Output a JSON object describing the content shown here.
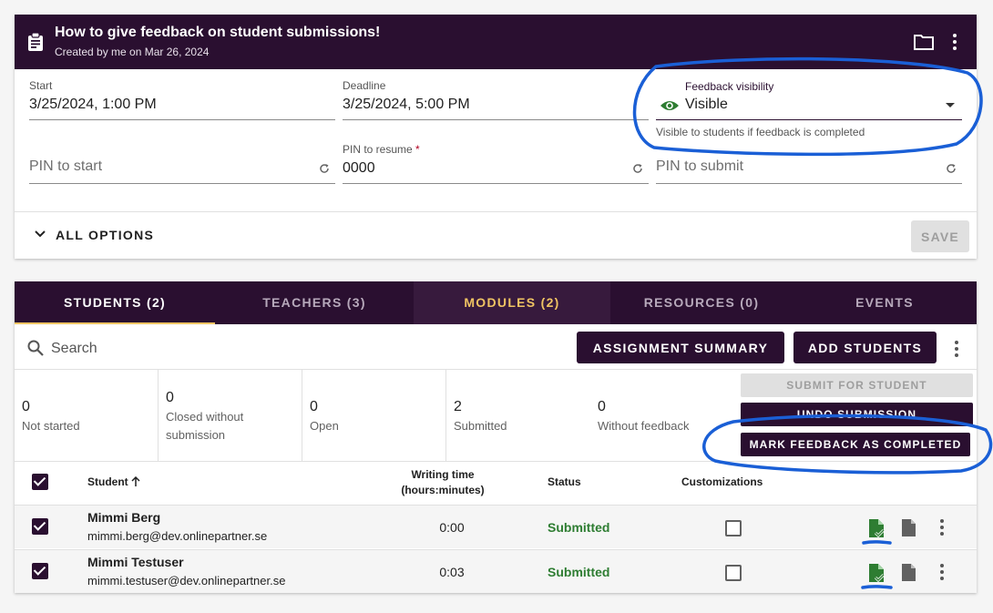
{
  "assignment": {
    "title": "How to give feedback on student submissions!",
    "subtitle": "Created by me on Mar 26, 2024",
    "header_icons": [
      "clipboard-icon",
      "folder-icon",
      "more-vert-icon"
    ]
  },
  "fields": {
    "start": {
      "label": "Start",
      "value": "3/25/2024, 1:00 PM"
    },
    "deadline": {
      "label": "Deadline",
      "value": "3/25/2024, 5:00 PM"
    },
    "feedback_visibility": {
      "label": "Feedback visibility",
      "value": "Visible",
      "hint": "Visible to students if feedback is completed",
      "icon": "eye-icon"
    },
    "pin_start": {
      "placeholder": "PIN to start"
    },
    "pin_resume": {
      "label": "PIN to resume",
      "required_mark": "*",
      "value": "0000"
    },
    "pin_submit": {
      "placeholder": "PIN to submit"
    }
  },
  "options": {
    "all_options_label": "ALL OPTIONS",
    "save_label": "SAVE"
  },
  "tabs": [
    {
      "label": "STUDENTS (2)",
      "active": true
    },
    {
      "label": "TEACHERS (3)"
    },
    {
      "label": "MODULES (2)",
      "highlight": true
    },
    {
      "label": "RESOURCES (0)"
    },
    {
      "label": "EVENTS"
    }
  ],
  "toolbar": {
    "search_placeholder": "Search",
    "assignment_summary_label": "ASSIGNMENT SUMMARY",
    "add_students_label": "ADD STUDENTS"
  },
  "stats": [
    {
      "value": "0",
      "label": "Not started"
    },
    {
      "value": "0",
      "label": "Closed without submission"
    },
    {
      "value": "0",
      "label": "Open"
    },
    {
      "value": "2",
      "label": "Submitted"
    },
    {
      "value": "0",
      "label": "Without feedback"
    }
  ],
  "actions": {
    "submit_for_student": "SUBMIT FOR STUDENT",
    "undo_submission": "UNDO SUBMISSION",
    "mark_feedback_completed": "MARK FEEDBACK AS COMPLETED"
  },
  "table": {
    "headers": {
      "student": "Student",
      "writing_time_line1": "Writing time",
      "writing_time_line2": "(hours:minutes)",
      "status": "Status",
      "customizations": "Customizations"
    },
    "rows": [
      {
        "name": "Mimmi Berg",
        "email": "mimmi.berg@dev.onlinepartner.se",
        "writing_time": "0:00",
        "status": "Submitted",
        "checked": true
      },
      {
        "name": "Mimmi Testuser",
        "email": "mimmi.testuser@dev.onlinepartner.se",
        "writing_time": "0:03",
        "status": "Submitted",
        "checked": true
      }
    ]
  },
  "colors": {
    "brand_dark": "#2a0f30",
    "accent_gold": "#f0c463",
    "status_green": "#2e7d32",
    "annotation_blue": "#1a5fd6"
  }
}
